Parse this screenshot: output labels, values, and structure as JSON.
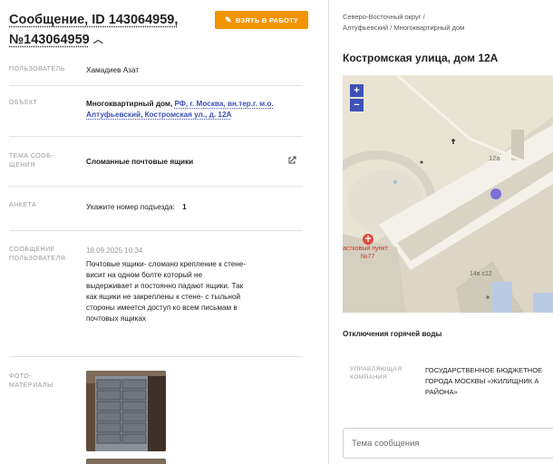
{
  "header": {
    "title_line1": "Сообщение, ID 143064959,",
    "title_line2": "№143064959",
    "take_button": "ВЗЯТЬ В РАБОТУ"
  },
  "fields": {
    "user_label": "ПОЛЬЗОВАТЕЛЬ",
    "user_value": "Хамадиев Азат",
    "object_label": "ОБЪЕКТ",
    "object_value_bold": "Многоквартирный дом, ",
    "object_value_link": "РФ, г. Москва, вн.тер.г. м.о. Алтуфьевский, Костромская ул., д. 12А",
    "topic_label": "ТЕМА СООБ-\nЩЕНИЯ",
    "topic_value": "Сломанные почтовые ящики",
    "survey_label": "АНКЕТА",
    "survey_question": "Укажите номер подъезда:",
    "survey_answer": "1",
    "message_label": "СООБЩЕНИЕ ПОЛЬЗОВАТЕЛЯ",
    "message_date": "18.09.2025 10:34",
    "message_text": "Почтовые ящики- сломано крепление к стене- висит на одном болте который не выдерживает и постоянно падают ящики. Так как ящики не закреплены к стене- с тыльной стороны имеется доступ ко всем письмам в почтовых ящиках",
    "photos_label": "ФОТО-\nМАТЕРИАЛЫ"
  },
  "right": {
    "breadcrumb_1": "Северо-Восточный округ /",
    "breadcrumb_2": "Алтуфьевский / Многоквартирный дом",
    "address_title": "Костромская улица, дом 12А",
    "map": {
      "zoom_in": "+",
      "zoom_out": "−",
      "label_building": "12а",
      "label_point": "астковый пункт",
      "label_point_num": "№77",
      "label_building2": "14в с12"
    },
    "outage_title": "Отключения горячей воды",
    "company_label": "УПРАВЛЯЮЩАЯ КОМПАНИЯ",
    "company_value": "ГОСУДАРСТВЕННОЕ БЮДЖЕТНОЕ ГОРОДА МОСКВЫ «ЖИЛИЩНИК А РАЙОНА»",
    "topic_input_placeholder": "Тема сообщения"
  },
  "colors": {
    "accent": "#f29400",
    "link": "#3f51b5",
    "map_marker": "#7b6fd6"
  }
}
